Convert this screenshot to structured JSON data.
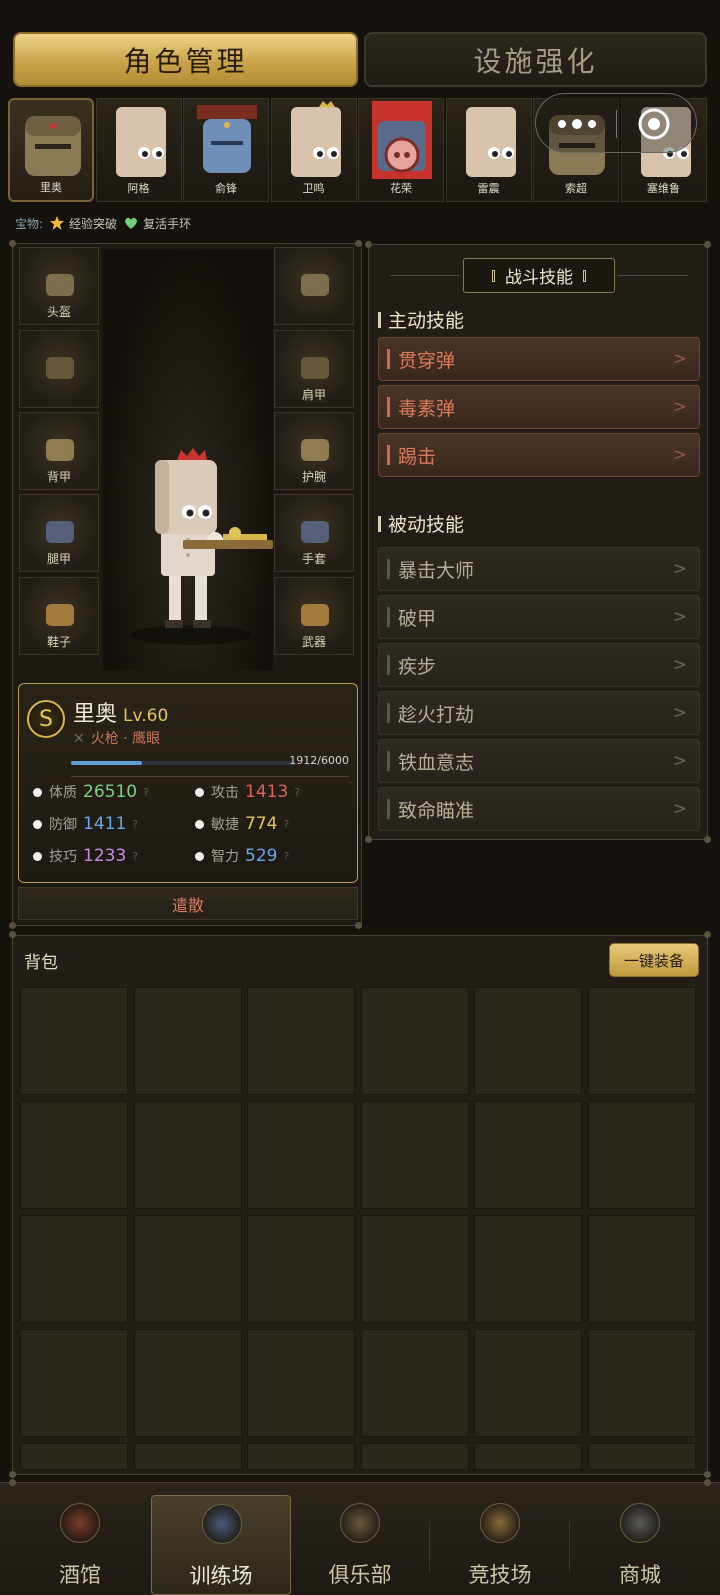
{
  "top_tabs": {
    "active": "角色管理",
    "inactive": "设施强化"
  },
  "heroes": [
    {
      "name": "里奥",
      "selected": true,
      "head": "knight-helmet"
    },
    {
      "name": "阿格",
      "selected": false,
      "head": "paper-bag"
    },
    {
      "name": "俞锋",
      "selected": false,
      "head": "blue-helmet"
    },
    {
      "name": "卫鸣",
      "selected": false,
      "head": "paper-bag-crown"
    },
    {
      "name": "花荣",
      "selected": false,
      "head": "pig-mask"
    },
    {
      "name": "雷震",
      "selected": false,
      "head": "paper-bag"
    },
    {
      "name": "索超",
      "selected": false,
      "head": "knight-helmet"
    },
    {
      "name": "塞维鲁",
      "selected": false,
      "head": "paper-bag"
    }
  ],
  "treasures": {
    "label": "宝物:",
    "items": [
      {
        "name": "经验突破",
        "icon": "star-icon",
        "color": "#f2b93b"
      },
      {
        "name": "复活手环",
        "icon": "heart-icon",
        "color": "#6fcf7a"
      }
    ]
  },
  "equipment_slots": {
    "left": [
      "头盔",
      "",
      "背甲",
      "腿甲",
      "鞋子"
    ],
    "right": [
      "",
      "肩甲",
      "护腕",
      "手套",
      "武器"
    ]
  },
  "hero_info": {
    "grade": "S",
    "name": "里奥",
    "level": "Lv.60",
    "class": "火枪 · 鹰眼",
    "exp_text": "1912/6000",
    "exp_current": 1912,
    "exp_max": 6000,
    "stats": [
      {
        "name": "体质",
        "value": "26510",
        "color": "#7fcf87"
      },
      {
        "name": "攻击",
        "value": "1413",
        "color": "#e0605a"
      },
      {
        "name": "防御",
        "value": "1411",
        "color": "#6aa6ea"
      },
      {
        "name": "敏捷",
        "value": "774",
        "color": "#e3c564"
      },
      {
        "name": "技巧",
        "value": "1233",
        "color": "#c58be6"
      },
      {
        "name": "智力",
        "value": "529",
        "color": "#6aa6ea"
      }
    ],
    "stat_hint": "?",
    "dismiss_label": "遣散"
  },
  "skills": {
    "header": "战斗技能",
    "active_title": "主动技能",
    "active": [
      "贯穿弹",
      "毒素弹",
      "踢击"
    ],
    "passive_title": "被动技能",
    "passive": [
      "暴击大师",
      "破甲",
      "疾步",
      "趁火打劫",
      "铁血意志",
      "致命瞄准"
    ],
    "arrow": ">"
  },
  "backpack": {
    "title": "背包",
    "equip_all_label": "一键装备"
  },
  "bottom_nav": [
    {
      "label": "酒馆",
      "icon": "tavern-icon",
      "active": false
    },
    {
      "label": "训练场",
      "icon": "training-icon",
      "active": true
    },
    {
      "label": "俱乐部",
      "icon": "club-icon",
      "active": false
    },
    {
      "label": "竞技场",
      "icon": "arena-icon",
      "active": false
    },
    {
      "label": "商城",
      "icon": "shop-icon",
      "active": false
    }
  ]
}
